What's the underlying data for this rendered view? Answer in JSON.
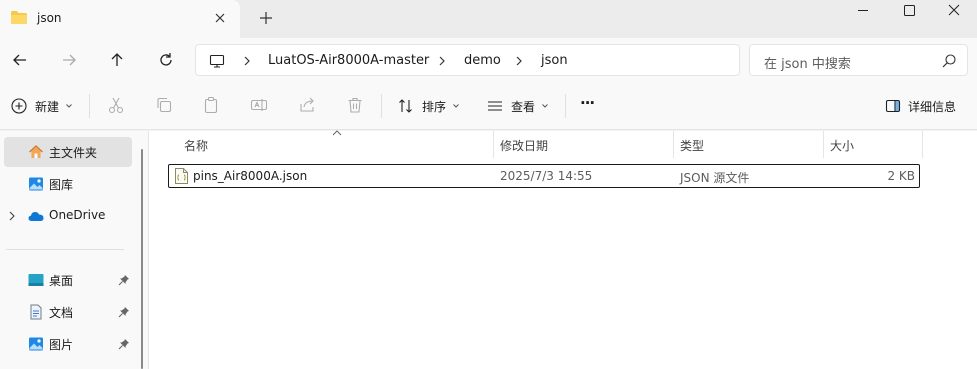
{
  "tab": {
    "title": "json"
  },
  "address": {
    "breadcrumb": [
      "LuatOS-Air8000A-master",
      "demo",
      "json"
    ],
    "search_placeholder": "在 json 中搜索"
  },
  "toolbar": {
    "new_label": "新建",
    "sort_label": "排序",
    "view_label": "查看",
    "more_label": "···",
    "details_label": "详细信息"
  },
  "sidebar": {
    "items": [
      {
        "label": "主文件夹",
        "icon": "home-icon"
      },
      {
        "label": "图库",
        "icon": "gallery-icon"
      },
      {
        "label": "OneDrive",
        "icon": "cloud-icon"
      },
      {
        "label": "桌面",
        "icon": "desktop-icon"
      },
      {
        "label": "文档",
        "icon": "documents-icon"
      },
      {
        "label": "图片",
        "icon": "pictures-icon"
      }
    ]
  },
  "columns": {
    "name": "名称",
    "modified": "修改日期",
    "type": "类型",
    "size": "大小"
  },
  "files": [
    {
      "name": "pins_Air8000A.json",
      "modified": "2025/7/3 14:55",
      "type": "JSON 源文件",
      "size": "2 KB"
    }
  ],
  "colors": {
    "accent": "#0067c0",
    "folder": "#f8c84a"
  }
}
